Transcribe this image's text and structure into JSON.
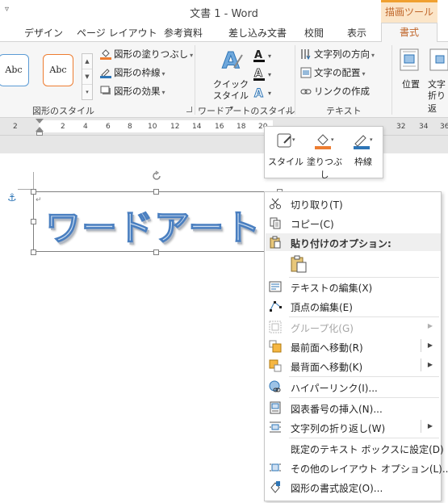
{
  "titlebar": {
    "title": "文書 1 - Word",
    "context_tab": "描画ツール",
    "qat_icon": "▿"
  },
  "tabs": [
    {
      "label": "デザイン"
    },
    {
      "label": "ページ レイアウト"
    },
    {
      "label": "参考資料"
    },
    {
      "label": "差し込み文書"
    },
    {
      "label": "校閲"
    },
    {
      "label": "表示"
    }
  ],
  "active_tab": "書式",
  "ribbon": {
    "shape_styles": {
      "style1": "Abc",
      "style2": "Abc",
      "fill": "図形の塗りつぶし",
      "outline": "図形の枠線",
      "effects": "図形の効果",
      "group_label": "図形のスタイル"
    },
    "wordart_styles": {
      "quick_styles_line1": "クイック",
      "quick_styles_line2": "スタイル",
      "group_label": "ワードアートのスタイル"
    },
    "text": {
      "direction": "文字列の方向",
      "align": "文字の配置",
      "link": "リンクの作成",
      "group_label": "テキスト"
    },
    "arrange": {
      "position": "位置",
      "wrap_line1": "文字",
      "wrap_line2": "折り返"
    }
  },
  "ruler": {
    "ticks": [
      "2",
      "2",
      "4",
      "6",
      "8",
      "10",
      "12",
      "14",
      "16",
      "18",
      "20",
      "32",
      "34",
      "36"
    ]
  },
  "mini_toolbar": {
    "style": "スタイル",
    "fill": "塗りつぶし",
    "outline": "枠線",
    "accent_fill": "#ed7d31",
    "accent_line": "#2e75b6"
  },
  "wordart": {
    "text": "ワードアート",
    "para_mark": "↵"
  },
  "context_menu": {
    "cut": "切り取り(T)",
    "copy": "コピー(C)",
    "paste_options": "貼り付けのオプション:",
    "edit_text": "テキストの編集(X)",
    "edit_points": "頂点の編集(E)",
    "group": "グループ化(G)",
    "bring_front": "最前面へ移動(R)",
    "send_back": "最背面へ移動(K)",
    "hyperlink": "ハイパーリンク(I)...",
    "insert_caption": "図表番号の挿入(N)...",
    "wrap_text": "文字列の折り返し(W)",
    "set_default_textbox": "既定のテキスト ボックスに設定(D)",
    "more_layout": "その他のレイアウト オプション(L)...",
    "format_shape": "図形の書式設定(O)..."
  }
}
